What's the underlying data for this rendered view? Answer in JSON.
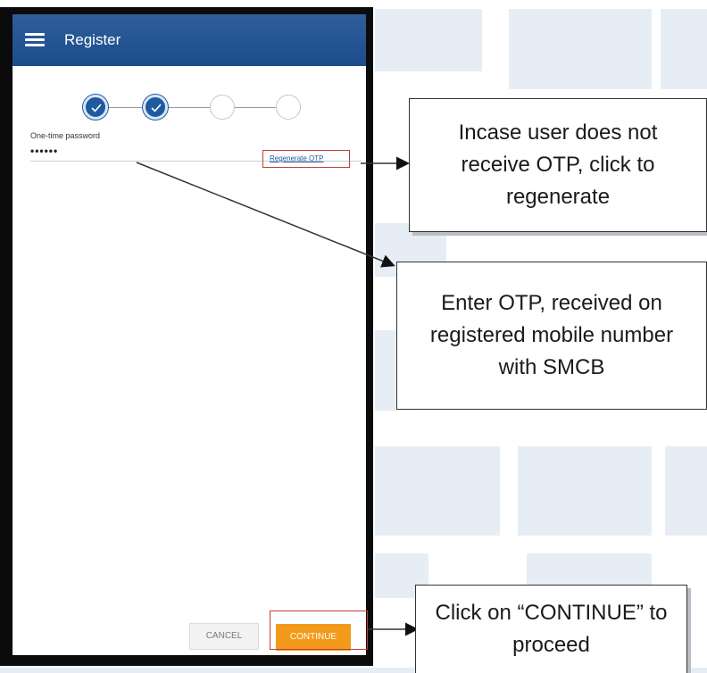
{
  "app": {
    "title": "Register",
    "menu_icon": "hamburger-menu-icon"
  },
  "steps": [
    {
      "state": "done"
    },
    {
      "state": "done"
    },
    {
      "state": "pending"
    },
    {
      "state": "pending"
    }
  ],
  "otp": {
    "label": "One-time password",
    "value": "••••••"
  },
  "regenerate_link": "Regenerate OTP",
  "buttons": {
    "cancel": "CANCEL",
    "continue": "CONTINUE"
  },
  "callouts": {
    "regenerate": "Incase user does not receive OTP, click to regenerate",
    "enter_otp": "Enter OTP, received on registered mobile number with SMCB",
    "continue": "Click on “CONTINUE” to proceed"
  },
  "colors": {
    "appbar": "#1d4c8b",
    "step_done": "#1e5aa0",
    "continue_button": "#f39a1a",
    "highlight_border": "#c43b3b"
  }
}
